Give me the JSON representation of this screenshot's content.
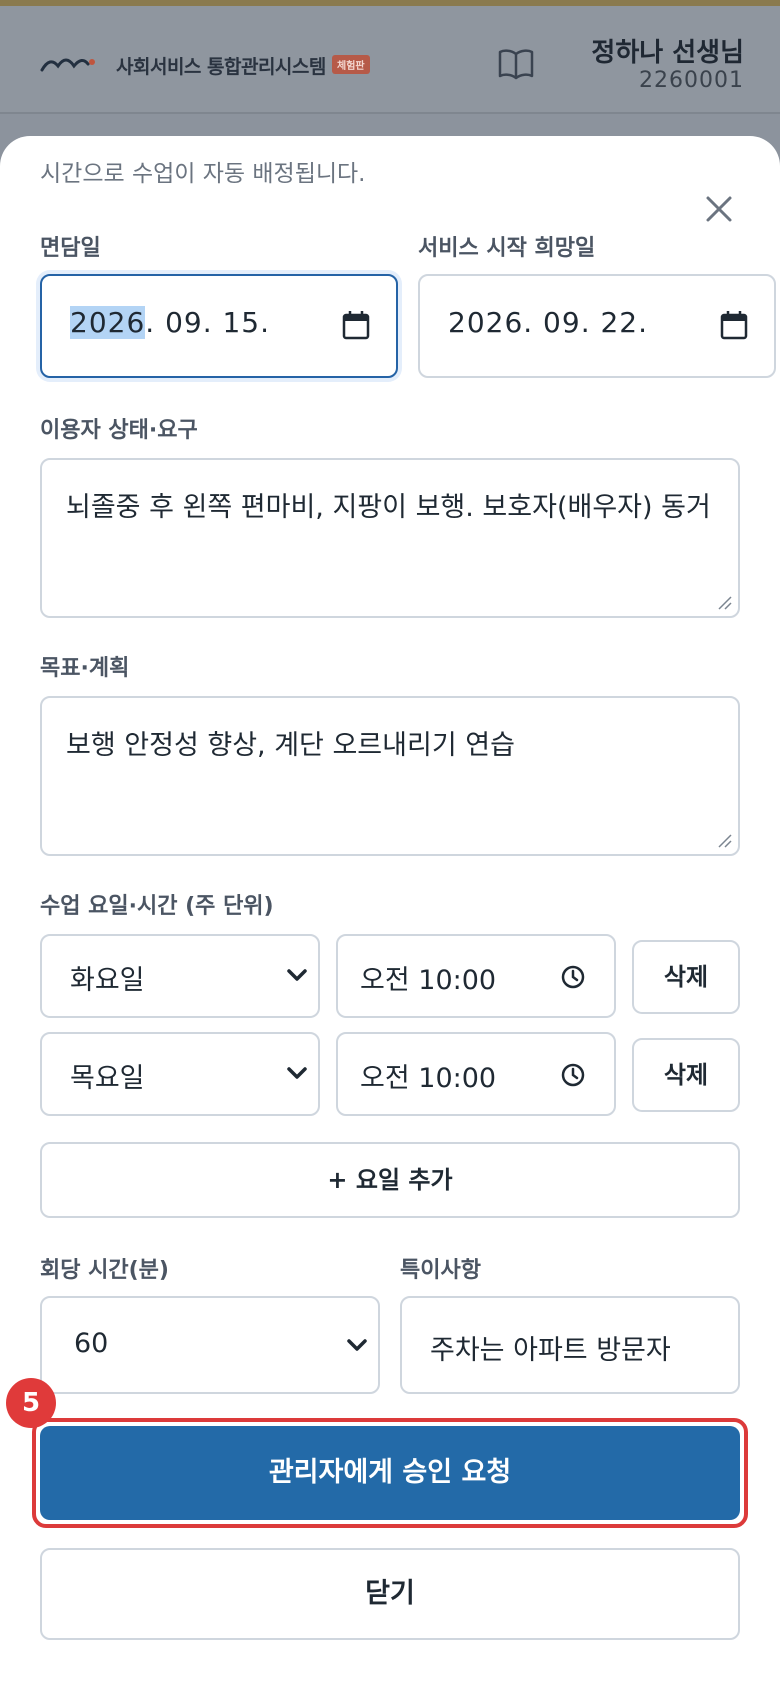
{
  "header": {
    "brand": "사회서비스 통합관리시스템",
    "badge": "체험판",
    "user_name": "정하나 선생님",
    "user_id": "2260001"
  },
  "sheet": {
    "note": "시간으로 수업이 자동 배정됩니다.",
    "interview_date": {
      "label": "면담일",
      "value_year": "2026",
      "value_rest": ". 09. 15."
    },
    "start_date": {
      "label": "서비스 시작 희망일",
      "value": "2026. 09. 22."
    },
    "status": {
      "label": "이용자 상태·요구",
      "value": "뇌졸중 후 왼쪽 편마비, 지팡이 보행. 보호자(배우자) 동거"
    },
    "goal": {
      "label": "목표·계획",
      "value": "보행 안정성 향상, 계단 오르내리기 연습"
    },
    "schedule": {
      "label": "수업 요일·시간 (주 단위)",
      "rows": [
        {
          "day": "화요일",
          "time": "오전 10:00",
          "delete": "삭제"
        },
        {
          "day": "목요일",
          "time": "오전 10:00",
          "delete": "삭제"
        }
      ],
      "add_label": "+ 요일 추가"
    },
    "duration": {
      "label": "회당 시간(분)",
      "value": "60"
    },
    "remarks": {
      "label": "특이사항",
      "value": "주차는 아파트 방문자"
    },
    "submit_label": "관리자에게 승인 요청",
    "close_label": "닫기",
    "step_number": "5"
  }
}
